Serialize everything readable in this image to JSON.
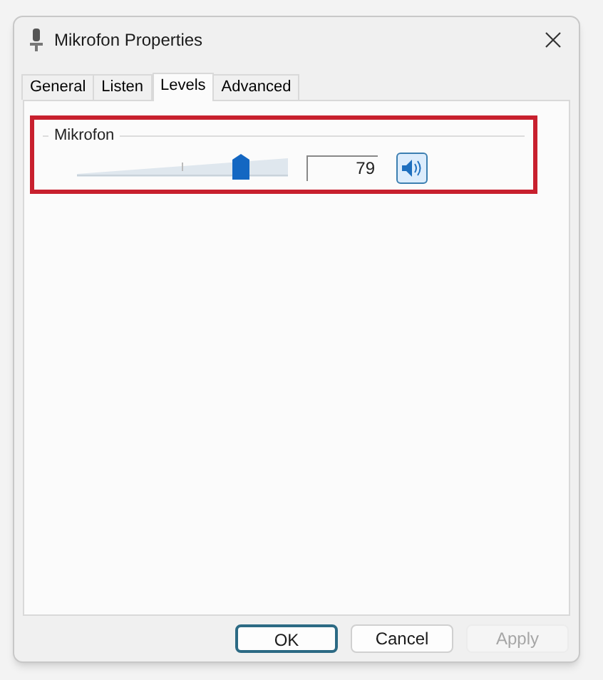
{
  "window": {
    "title": "Mikrofon Properties"
  },
  "tabs": [
    {
      "label": "General",
      "selected": false
    },
    {
      "label": "Listen",
      "selected": false
    },
    {
      "label": "Levels",
      "selected": true
    },
    {
      "label": "Advanced",
      "selected": false
    }
  ],
  "levels": {
    "group_label": "Mikrofon",
    "level": 0.78,
    "value": "79",
    "muted": false
  },
  "buttons": [
    {
      "label": "OK",
      "kind": "default",
      "disabled": false
    },
    {
      "label": "Cancel",
      "kind": "normal",
      "disabled": false
    },
    {
      "label": "Apply",
      "kind": "normal",
      "disabled": true
    }
  ]
}
